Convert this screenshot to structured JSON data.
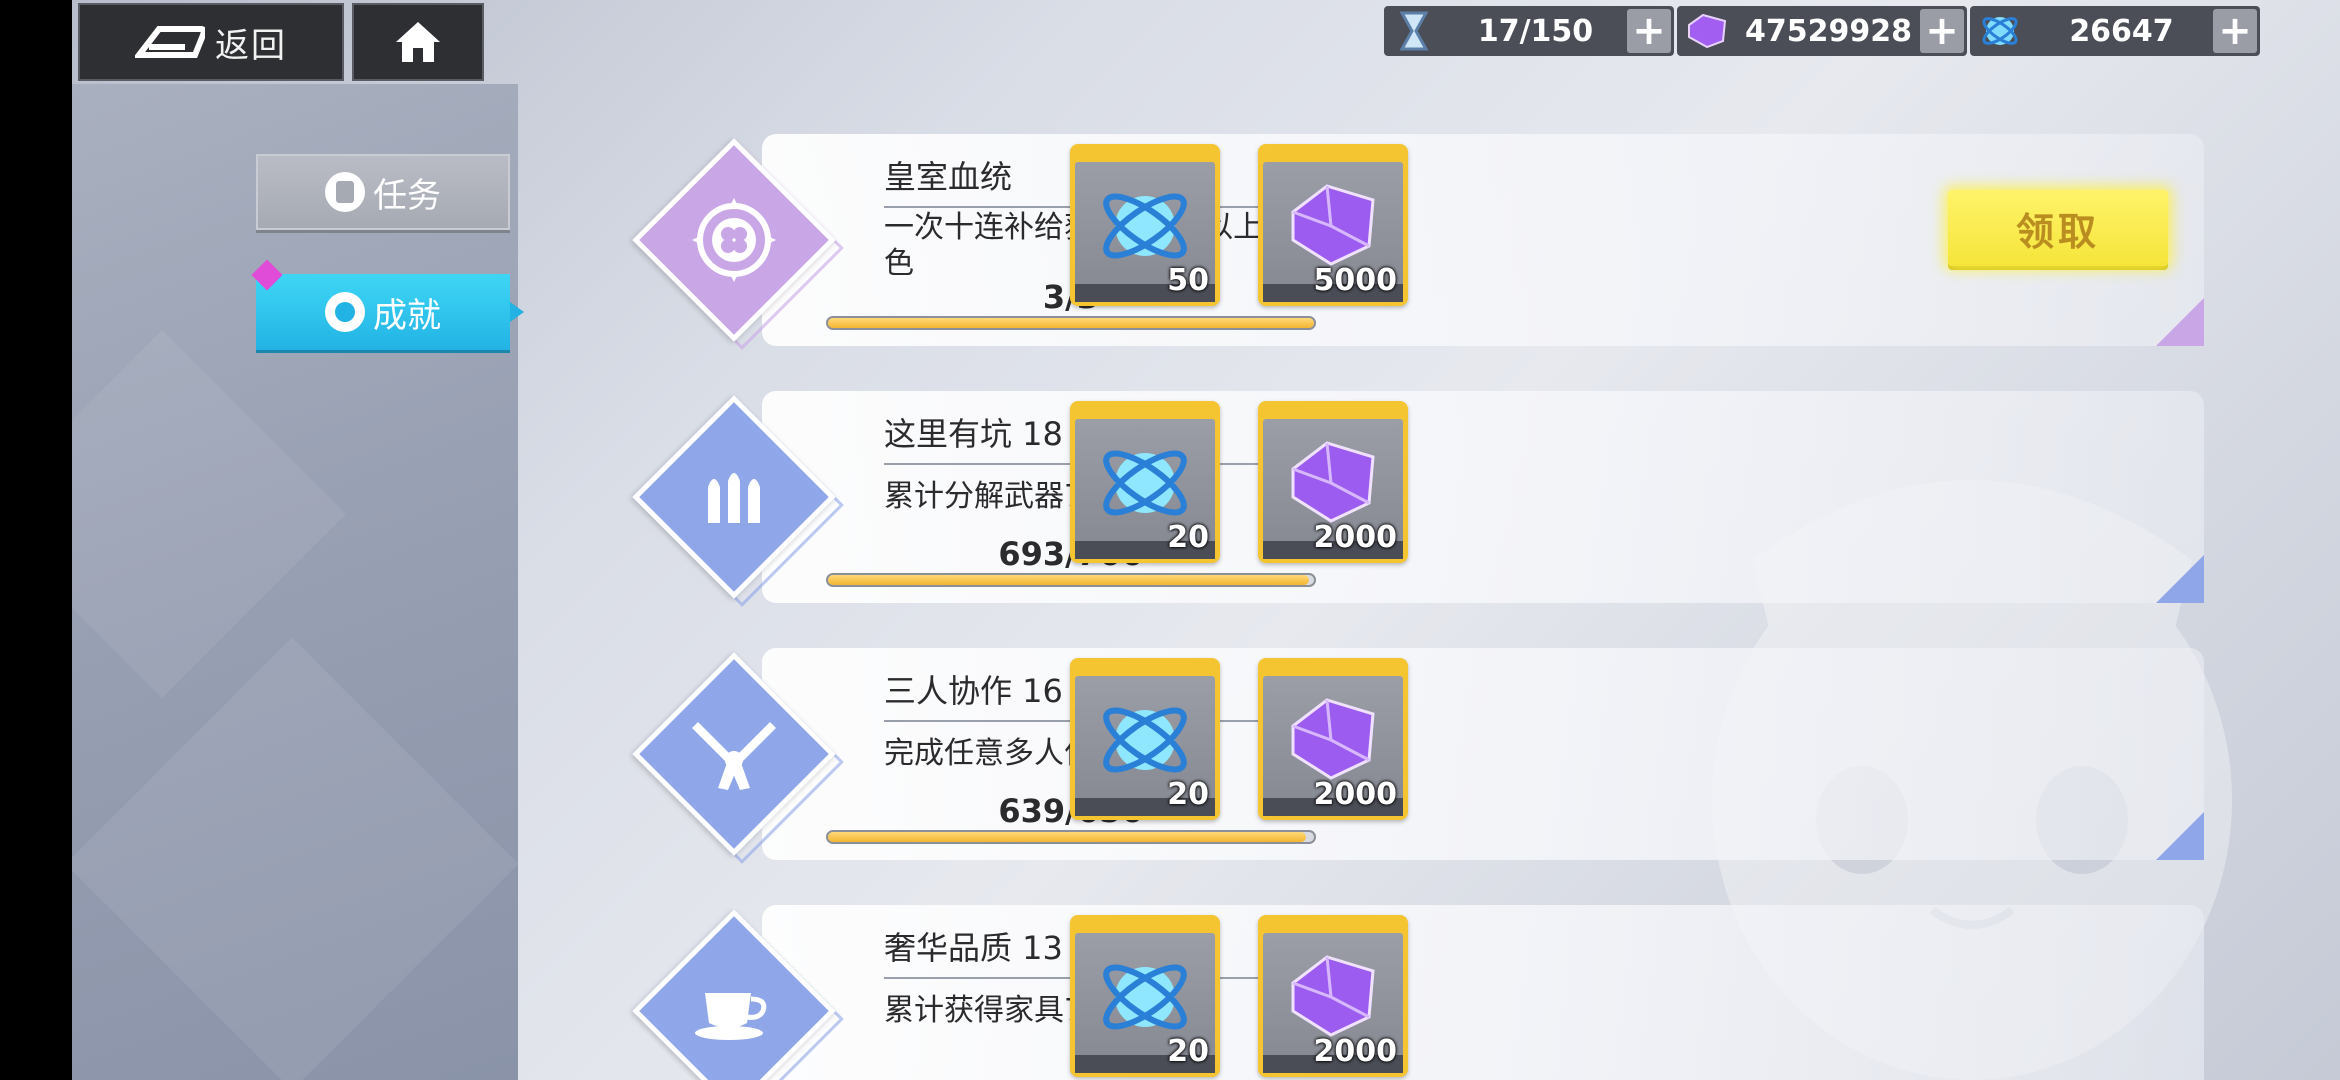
{
  "topbar": {
    "back_label": "返回",
    "resources": [
      {
        "icon": "hourglass-icon",
        "value": "17/150"
      },
      {
        "icon": "purple-crystal-icon",
        "value": "47529928"
      },
      {
        "icon": "blue-orb-icon",
        "value": "26647"
      }
    ]
  },
  "sidebar": {
    "tabs": [
      {
        "label": "任务",
        "active": false
      },
      {
        "label": "成就",
        "active": true
      }
    ]
  },
  "achievements": [
    {
      "title": "皇室血统",
      "description": "一次十连补给获得3位及以上4星角色",
      "progress_text": "3/3",
      "progress": 1.0,
      "badge_color": "#c9a6e6",
      "badge_icon": "clover-emblem-icon",
      "rewards": [
        {
          "icon": "blue-orb-icon",
          "count": "50"
        },
        {
          "icon": "purple-crystal-icon",
          "count": "5000"
        }
      ],
      "claim_label": "领取"
    },
    {
      "title": "这里有坑 18",
      "description": "累计分解武器700把",
      "progress_text": "693/700",
      "progress": 0.99,
      "badge_color": "#8fa6e8",
      "badge_icon": "bullets-icon",
      "rewards": [
        {
          "icon": "blue-orb-icon",
          "count": "20"
        },
        {
          "icon": "purple-crystal-icon",
          "count": "2000"
        }
      ]
    },
    {
      "title": "三人协作 16",
      "description": "完成任意多人作战650次",
      "progress_text": "639/650",
      "progress": 0.983,
      "badge_color": "#8fa6e8",
      "badge_icon": "crossed-revolvers-icon",
      "rewards": [
        {
          "icon": "blue-orb-icon",
          "count": "20"
        },
        {
          "icon": "purple-crystal-icon",
          "count": "2000"
        }
      ]
    },
    {
      "title": "奢华品质 13",
      "description": "累计获得家具720个",
      "progress_text": "",
      "progress": 0,
      "badge_color": "#8fa6e8",
      "badge_icon": "teacup-icon",
      "rewards": [
        {
          "icon": "blue-orb-icon",
          "count": "20"
        },
        {
          "icon": "purple-crystal-icon",
          "count": "2000"
        }
      ]
    }
  ],
  "colors": {
    "accent_blue": "#22b3e4",
    "claim_yellow": "#f5e53a",
    "progress_fill": "#f3b532",
    "reward_frame": "#f5c431"
  }
}
